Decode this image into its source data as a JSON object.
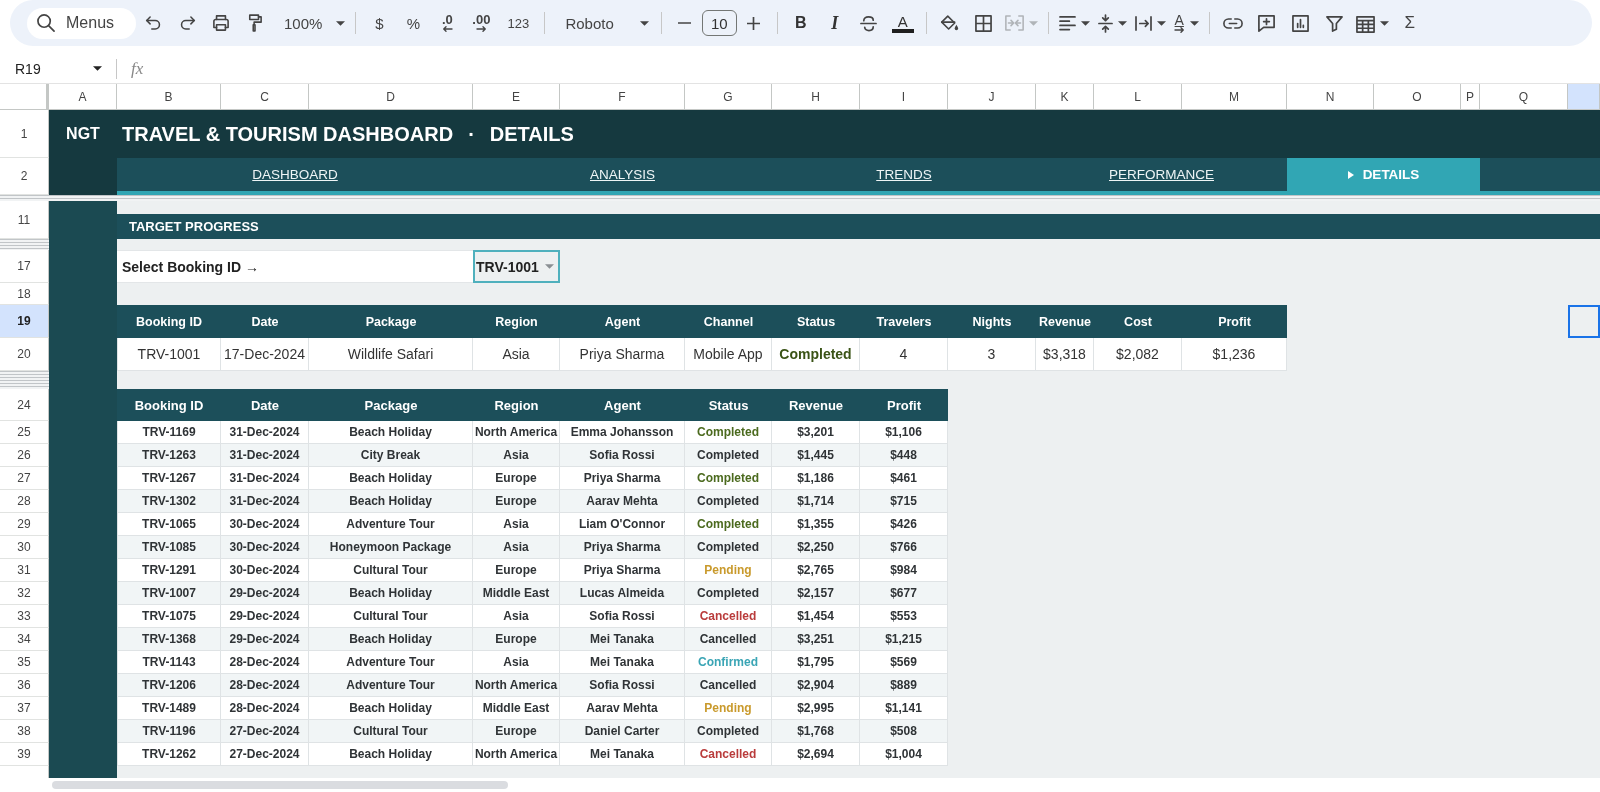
{
  "toolbar": {
    "search": {
      "placeholder": "Menus"
    },
    "zoom": "100%",
    "currency": "$",
    "percent": "%",
    "decrease_decimal": ".0",
    "increase_decimal": ".00",
    "number_format": "123",
    "font": "Roboto",
    "font_size": "10",
    "bold": "B",
    "italic": "I",
    "text_color": "A",
    "merge_disabled": true,
    "text_rotation": "A",
    "sum": "Σ"
  },
  "formula_bar": {
    "name_box": "R19",
    "fx": "fx"
  },
  "column_headers": [
    {
      "label": "A",
      "selected": false
    },
    {
      "label": "B",
      "selected": false
    },
    {
      "label": "C",
      "selected": false
    },
    {
      "label": "D",
      "selected": false
    },
    {
      "label": "E",
      "selected": false
    },
    {
      "label": "F",
      "selected": false
    },
    {
      "label": "G",
      "selected": false
    },
    {
      "label": "H",
      "selected": false
    },
    {
      "label": "I",
      "selected": false
    },
    {
      "label": "J",
      "selected": false
    },
    {
      "label": "K",
      "selected": false
    },
    {
      "label": "L",
      "selected": false
    },
    {
      "label": "M",
      "selected": false
    },
    {
      "label": "N",
      "selected": false
    },
    {
      "label": "O",
      "selected": false
    },
    {
      "label": "P",
      "selected": false
    },
    {
      "label": "Q",
      "selected": false
    }
  ],
  "cut_column": {
    "selected": true
  },
  "row_headers": [
    {
      "label": "1",
      "selected": false
    },
    {
      "label": "2",
      "selected": false
    },
    {
      "label": "11",
      "selected": false
    },
    {
      "label": "17",
      "selected": false
    },
    {
      "label": "18",
      "selected": false
    },
    {
      "label": "19",
      "selected": true
    },
    {
      "label": "20",
      "selected": false
    },
    {
      "label": "24",
      "selected": false
    },
    {
      "label": "25",
      "selected": false
    },
    {
      "label": "26",
      "selected": false
    },
    {
      "label": "27",
      "selected": false
    },
    {
      "label": "28",
      "selected": false
    },
    {
      "label": "29",
      "selected": false
    },
    {
      "label": "30",
      "selected": false
    },
    {
      "label": "31",
      "selected": false
    },
    {
      "label": "32",
      "selected": false
    },
    {
      "label": "33",
      "selected": false
    },
    {
      "label": "34",
      "selected": false
    },
    {
      "label": "35",
      "selected": false
    },
    {
      "label": "36",
      "selected": false
    },
    {
      "label": "37",
      "selected": false
    },
    {
      "label": "38",
      "selected": false
    },
    {
      "label": "39",
      "selected": false
    }
  ],
  "sheet": {
    "brand": "NGT",
    "title": "TRAVEL & TOURISM DASHBOARD",
    "separator": "·",
    "page": "DETAILS",
    "tabs": [
      {
        "label": "DASHBOARD",
        "selected": false
      },
      {
        "label": "ANALYSIS",
        "selected": false
      },
      {
        "label": "TRENDS",
        "selected": false
      },
      {
        "label": "PERFORMANCE",
        "selected": false
      },
      {
        "label": "DETAILS",
        "selected": true
      }
    ],
    "section_title": "TARGET PROGRESS",
    "select_label": "Select Booking ID →",
    "selected_booking": "TRV-1001"
  },
  "detail_table": {
    "columns": [
      "Booking ID",
      "Date",
      "Package",
      "Region",
      "Agent",
      "Channel",
      "Status",
      "Travelers",
      "Nights",
      "Revenue",
      "Cost",
      "Profit"
    ],
    "row": {
      "booking_id": "TRV-1001",
      "date": "17-Dec-2024",
      "package": "Wildlife Safari",
      "region": "Asia",
      "agent": "Priya Sharma",
      "channel": "Mobile App",
      "status": "Completed",
      "color": "#3a5316",
      "travelers": "4",
      "nights": "3",
      "revenue": "$3,318",
      "cost": "$2,082",
      "profit": "$1,236"
    }
  },
  "bookings_table": {
    "columns": [
      "Booking ID",
      "Date",
      "Package",
      "Region",
      "Agent",
      "Status",
      "Revenue",
      "Profit"
    ],
    "rows": [
      {
        "booking_id": "TRV-1169",
        "date": "31-Dec-2024",
        "package": "Beach Holiday",
        "region": "North America",
        "agent": "Emma Johansson",
        "status": "Completed",
        "color": "#4b6a1e",
        "revenue": "$3,201",
        "profit": "$1,106"
      },
      {
        "booking_id": "TRV-1263",
        "date": "31-Dec-2024",
        "package": "City Break",
        "region": "Asia",
        "agent": "Sofia Rossi",
        "status": "Completed",
        "color": "#2f3336",
        "revenue": "$1,445",
        "profit": "$448"
      },
      {
        "booking_id": "TRV-1267",
        "date": "31-Dec-2024",
        "package": "Beach Holiday",
        "region": "Europe",
        "agent": "Priya Sharma",
        "status": "Completed",
        "color": "#4b6a1e",
        "revenue": "$1,186",
        "profit": "$461"
      },
      {
        "booking_id": "TRV-1302",
        "date": "31-Dec-2024",
        "package": "Beach Holiday",
        "region": "Europe",
        "agent": "Aarav Mehta",
        "status": "Completed",
        "color": "#2f3336",
        "revenue": "$1,714",
        "profit": "$715"
      },
      {
        "booking_id": "TRV-1065",
        "date": "30-Dec-2024",
        "package": "Adventure Tour",
        "region": "Asia",
        "agent": "Liam O'Connor",
        "status": "Completed",
        "color": "#4b6a1e",
        "revenue": "$1,355",
        "profit": "$426"
      },
      {
        "booking_id": "TRV-1085",
        "date": "30-Dec-2024",
        "package": "Honeymoon Package",
        "region": "Asia",
        "agent": "Priya Sharma",
        "status": "Completed",
        "color": "#2f3336",
        "revenue": "$2,250",
        "profit": "$766"
      },
      {
        "booking_id": "TRV-1291",
        "date": "30-Dec-2024",
        "package": "Cultural Tour",
        "region": "Europe",
        "agent": "Priya Sharma",
        "status": "Pending",
        "color": "#c99a2c",
        "revenue": "$2,765",
        "profit": "$984"
      },
      {
        "booking_id": "TRV-1007",
        "date": "29-Dec-2024",
        "package": "Beach Holiday",
        "region": "Middle East",
        "agent": "Lucas Almeida",
        "status": "Completed",
        "color": "#2f3336",
        "revenue": "$2,157",
        "profit": "$677"
      },
      {
        "booking_id": "TRV-1075",
        "date": "29-Dec-2024",
        "package": "Cultural Tour",
        "region": "Asia",
        "agent": "Sofia Rossi",
        "status": "Cancelled",
        "color": "#b93b3b",
        "revenue": "$1,454",
        "profit": "$553"
      },
      {
        "booking_id": "TRV-1368",
        "date": "29-Dec-2024",
        "package": "Beach Holiday",
        "region": "Europe",
        "agent": "Mei Tanaka",
        "status": "Cancelled",
        "color": "#2f3336",
        "revenue": "$3,251",
        "profit": "$1,215"
      },
      {
        "booking_id": "TRV-1143",
        "date": "28-Dec-2024",
        "package": "Adventure Tour",
        "region": "Asia",
        "agent": "Mei Tanaka",
        "status": "Confirmed",
        "color": "#3aa5b5",
        "revenue": "$1,795",
        "profit": "$569"
      },
      {
        "booking_id": "TRV-1206",
        "date": "28-Dec-2024",
        "package": "Adventure Tour",
        "region": "North America",
        "agent": "Sofia Rossi",
        "status": "Cancelled",
        "color": "#2f3336",
        "revenue": "$2,904",
        "profit": "$889"
      },
      {
        "booking_id": "TRV-1489",
        "date": "28-Dec-2024",
        "package": "Beach Holiday",
        "region": "Middle East",
        "agent": "Aarav Mehta",
        "status": "Pending",
        "color": "#c99a2c",
        "revenue": "$2,995",
        "profit": "$1,141"
      },
      {
        "booking_id": "TRV-1196",
        "date": "27-Dec-2024",
        "package": "Cultural Tour",
        "region": "Europe",
        "agent": "Daniel Carter",
        "status": "Completed",
        "color": "#2f3336",
        "revenue": "$1,768",
        "profit": "$508"
      },
      {
        "booking_id": "TRV-1262",
        "date": "27-Dec-2024",
        "package": "Beach Holiday",
        "region": "North America",
        "agent": "Mei Tanaka",
        "status": "Cancelled",
        "color": "#b93b3b",
        "revenue": "$2,694",
        "profit": "$1,004"
      }
    ]
  }
}
